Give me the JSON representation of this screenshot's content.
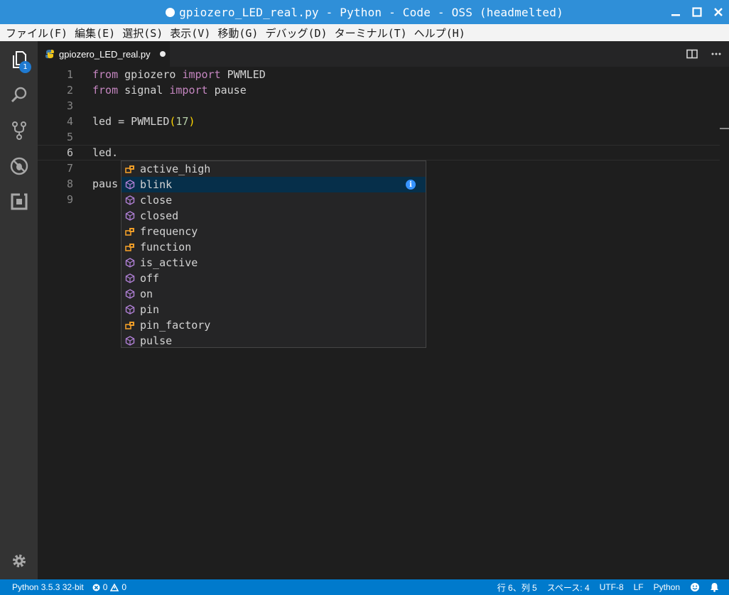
{
  "window": {
    "title": "gpiozero_LED_real.py - Python - Code - OSS (headmelted)"
  },
  "menu": [
    "ファイル(F)",
    "編集(E)",
    "選択(S)",
    "表示(V)",
    "移動(G)",
    "デバッグ(D)",
    "ターミナル(T)",
    "ヘルプ(H)"
  ],
  "activity": {
    "explorer_badge": "1"
  },
  "tab": {
    "filename": "gpiozero_LED_real.py"
  },
  "editor": {
    "line_numbers": [
      "1",
      "2",
      "3",
      "4",
      "5",
      "6",
      "7",
      "8",
      "9"
    ],
    "lines": {
      "l1": {
        "kw1": "from",
        "mod": " gpiozero ",
        "kw2": "import",
        "name": " PWMLED"
      },
      "l2": {
        "kw1": "from",
        "mod": " signal ",
        "kw2": "import",
        "name": " pause"
      },
      "l4": {
        "a": "led = PWMLED",
        "open": "(",
        "num": "17",
        "close": ")"
      },
      "l6": "led.",
      "l8": "paus"
    }
  },
  "suggest": {
    "items": [
      {
        "label": "active_high",
        "kind": "property-icon"
      },
      {
        "label": "blink",
        "kind": "method-icon"
      },
      {
        "label": "close",
        "kind": "method-icon"
      },
      {
        "label": "closed",
        "kind": "method-icon"
      },
      {
        "label": "frequency",
        "kind": "property-icon"
      },
      {
        "label": "function",
        "kind": "property-icon"
      },
      {
        "label": "is_active",
        "kind": "method-icon"
      },
      {
        "label": "off",
        "kind": "method-icon"
      },
      {
        "label": "on",
        "kind": "method-icon"
      },
      {
        "label": "pin",
        "kind": "method-icon"
      },
      {
        "label": "pin_factory",
        "kind": "property-icon"
      },
      {
        "label": "pulse",
        "kind": "method-icon"
      }
    ],
    "selected": "blink",
    "info_glyph": "i"
  },
  "status": {
    "interpreter": "Python 3.5.3 32-bit",
    "errors": "0",
    "warnings": "0",
    "position": "行 6、列 5",
    "indent": "スペース: 4",
    "encoding": "UTF-8",
    "eol": "LF",
    "language": "Python"
  },
  "colors": {
    "titlebar": "#2f8fd8",
    "statusbar": "#007acc",
    "keyword": "#c586c0",
    "number": "#b5cea8",
    "bracket": "#ffd700",
    "method_icon": "#b180d7",
    "property_icon": "#ee9d28"
  }
}
